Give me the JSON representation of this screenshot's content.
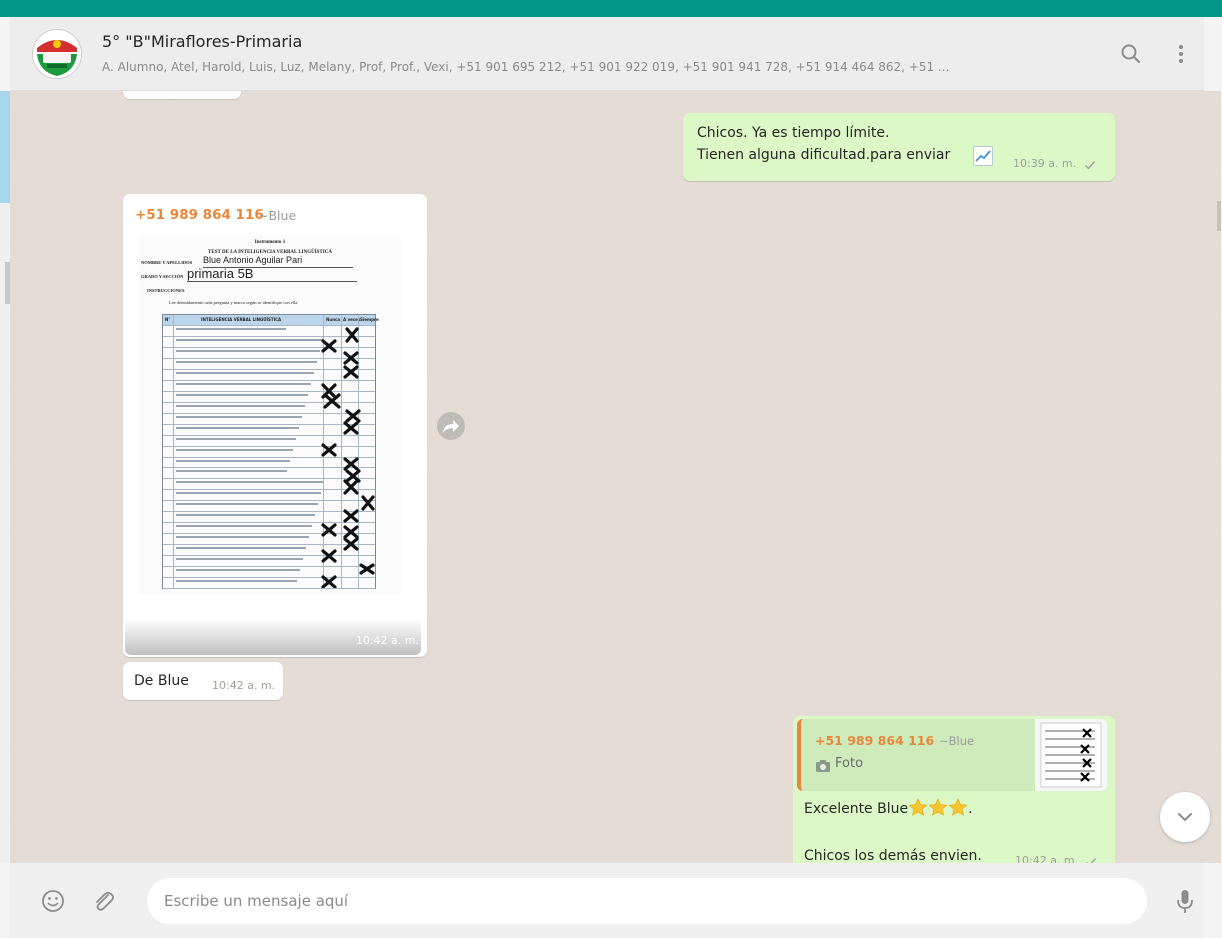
{
  "header": {
    "title": "5° \"B\"Miraflores-Primaria",
    "members": "A. Alumno, Atel, Harold, Luis, Luz, Melany, Prof, Prof., Vexi, +51 901 695 212, +51 901 922 019, +51 901 941 728, +51 914 464 862, +51 ...",
    "icons": [
      "group-avatar",
      "search-icon",
      "menu-icon"
    ]
  },
  "messages": [
    {
      "direction": "outgoing",
      "lines": [
        "Chicos. Ya es tiempo límite.",
        "Tienen alguna dificultad.para enviar"
      ],
      "emoji": "chart-increasing-icon",
      "time": "10:39 a. m."
    },
    {
      "direction": "incoming",
      "type": "image",
      "sender_phone": "+51 989 864 116",
      "sender_name": "~Blue",
      "time": "10:42 a. m.",
      "document": {
        "heading": "Instrumento 1",
        "title": "TEST DE LA INTELIGENCIA VERBAL LINGÜÍSTICA",
        "name_label": "NOMBRE Y APELLIDOS",
        "name_value": "Blue Antonio Aguilar Pari",
        "grade_label": "GRADO Y SECCIÓN",
        "grade_value": "primaria 5B",
        "instructions_label": "INSTRUCCIONES",
        "instructions": "Lee detenidamente cada pregunta y marca según se identifique con ella.",
        "columns": [
          "N°",
          "INTELIGENCIA VERBAL LINGÜÍSTICA",
          "Nunca",
          "A veces",
          "Siempre"
        ],
        "row_count": 24
      }
    },
    {
      "direction": "incoming",
      "text": "De Blue",
      "time": "10:42 a. m."
    },
    {
      "direction": "outgoing",
      "quote": {
        "sender_phone": "+51 989 864 116",
        "sender_name": "~Blue",
        "media_label": "Foto",
        "icon": "camera-icon"
      },
      "line1": "Excelente Blue",
      "line1_suffix": ".",
      "stars": 3,
      "line2": "Chicos los demás envien.",
      "time": "10:42 a. m."
    }
  ],
  "composer": {
    "placeholder": "Escribe un mensaje aquí",
    "icons": [
      "emoji-icon",
      "attach-icon",
      "microphone-icon"
    ]
  },
  "colors": {
    "brand": "#009688",
    "outgoing_bubble": "#dcf8c6",
    "incoming_bubble": "#ffffff",
    "chat_background": "#e5ddd5",
    "sender_orange": "#e8873b"
  }
}
